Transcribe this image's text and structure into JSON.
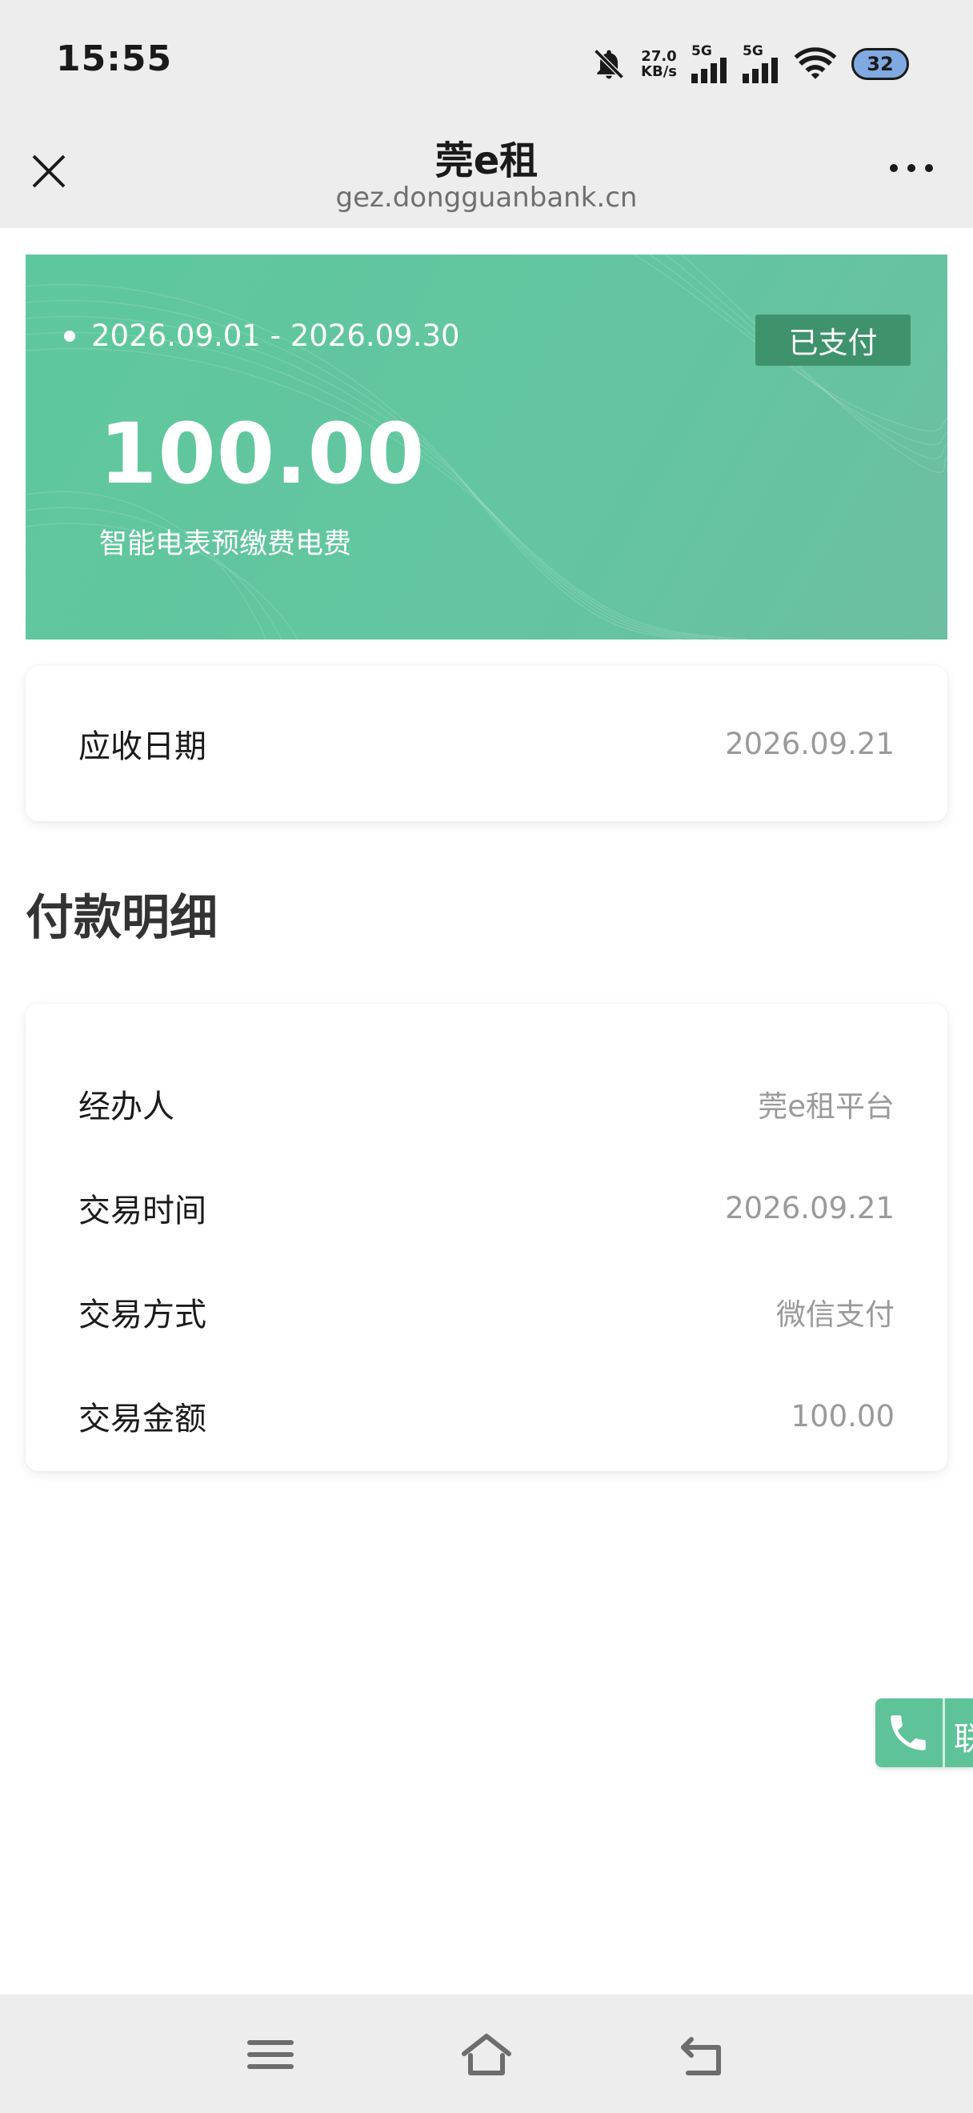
{
  "status_bar": {
    "time": "15:55",
    "speed_value": "27.0",
    "speed_unit": "KB/s",
    "signal1_label": "5G",
    "signal2_label": "5G",
    "battery": "32",
    "icons": [
      "bell-off-icon",
      "signal-icon",
      "signal-icon",
      "wifi-icon",
      "battery-icon"
    ]
  },
  "nav": {
    "title": "莞e租",
    "subtitle": "gez.dongguanbank.cn",
    "close_icon": "close-icon",
    "more_icon": "more-icon"
  },
  "banner": {
    "period": "2026.09.01 - 2026.09.30",
    "status": "已支付",
    "amount": "100.00",
    "description": "智能电表预缴费电费",
    "colors": {
      "bg": "#63c6a0",
      "badge": "#3e936c"
    }
  },
  "due": {
    "label": "应收日期",
    "value": "2026.09.21"
  },
  "payment_details": {
    "title": "付款明细",
    "rows": [
      {
        "label": "经办人",
        "value": "莞e租平台"
      },
      {
        "label": "交易时间",
        "value": "2026.09.21"
      },
      {
        "label": "交易方式",
        "value": "微信支付"
      },
      {
        "label": "交易金额",
        "value": "100.00"
      }
    ]
  },
  "contact": {
    "label": "联",
    "icon": "phone-icon"
  },
  "bottom_nav": {
    "icons": [
      "menu-icon",
      "home-icon",
      "back-icon"
    ]
  }
}
